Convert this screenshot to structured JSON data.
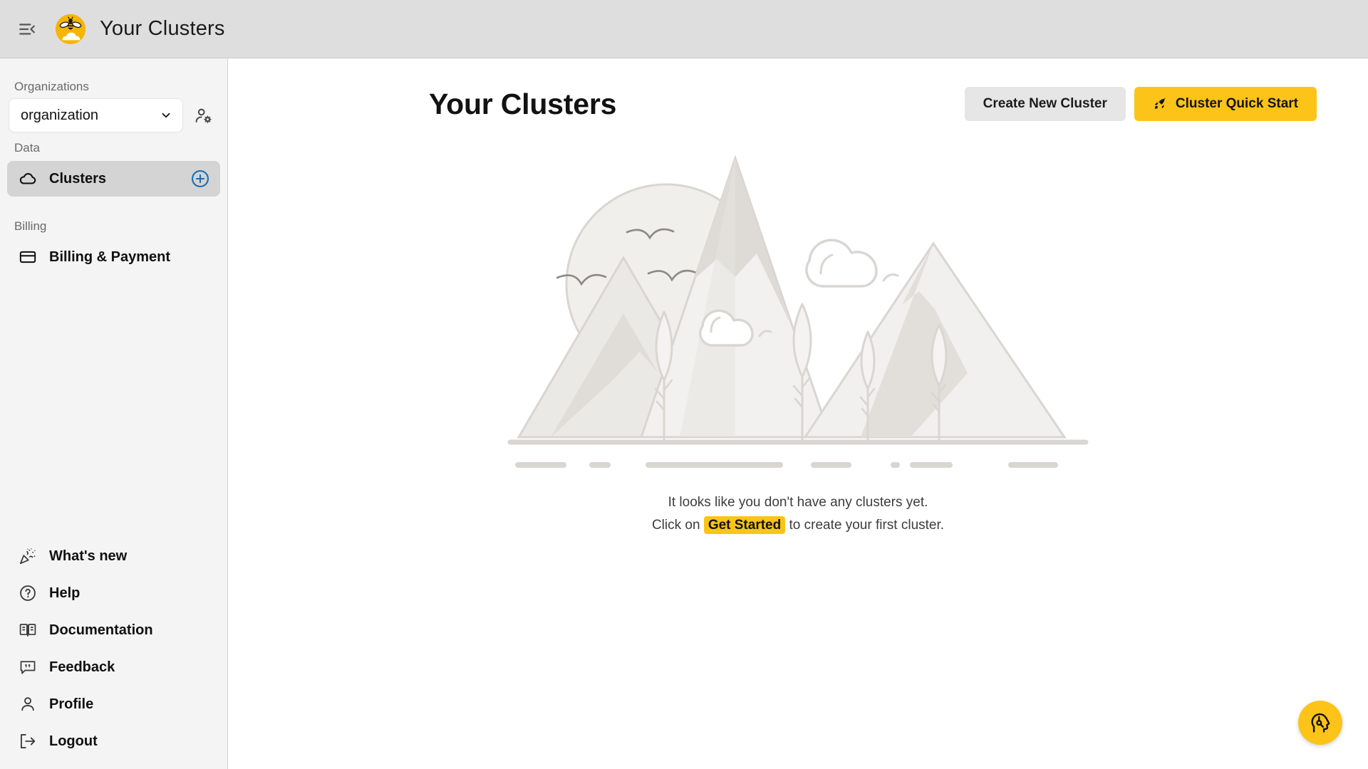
{
  "topbar": {
    "collapse_icon": "collapse-sidebar-icon",
    "logo_icon": "bee-cloud-logo-icon",
    "title": "Your Clusters"
  },
  "sidebar": {
    "organizations_label": "Organizations",
    "org_select": {
      "value": "organization",
      "chevron_icon": "chevron-down-icon"
    },
    "manage_users_icon": "user-settings-icon",
    "data_label": "Data",
    "billing_label": "Billing",
    "data_items": [
      {
        "label": "Clusters",
        "icon": "cloud-icon",
        "active": true,
        "trailing_icon": "plus-circle-icon"
      }
    ],
    "billing_items": [
      {
        "label": "Billing & Payment",
        "icon": "credit-card-icon",
        "active": false
      }
    ],
    "bottom_items": [
      {
        "label": "What's new",
        "icon": "party-popper-icon"
      },
      {
        "label": "Help",
        "icon": "question-circle-icon"
      },
      {
        "label": "Documentation",
        "icon": "open-book-icon"
      },
      {
        "label": "Feedback",
        "icon": "speech-bubble-icon"
      },
      {
        "label": "Profile",
        "icon": "person-icon"
      },
      {
        "label": "Logout",
        "icon": "logout-arrow-icon"
      }
    ]
  },
  "main": {
    "page_title": "Your Clusters",
    "create_button": "Create New Cluster",
    "quick_start_button": "Cluster Quick Start",
    "quick_start_icon": "rocket-icon",
    "illustration_name": "empty-state-mountains-illustration",
    "empty_line_1": "It looks like you don't have any clusters yet.",
    "empty_line_2_before": "Click on",
    "empty_line_2_highlight": "Get Started",
    "empty_line_2_after": "to create your first cluster.",
    "assistant_fab_icon": "ai-head-icon"
  },
  "colors": {
    "accent_yellow": "#fcc419",
    "topbar_bg": "#dedede",
    "sidebar_bg": "#f4f4f4",
    "active_nav_bg": "#d4d4d4",
    "plus_blue": "#1a6fb5",
    "illustration_gray": "#d9d6d2",
    "main_bg": "#ffffff"
  }
}
